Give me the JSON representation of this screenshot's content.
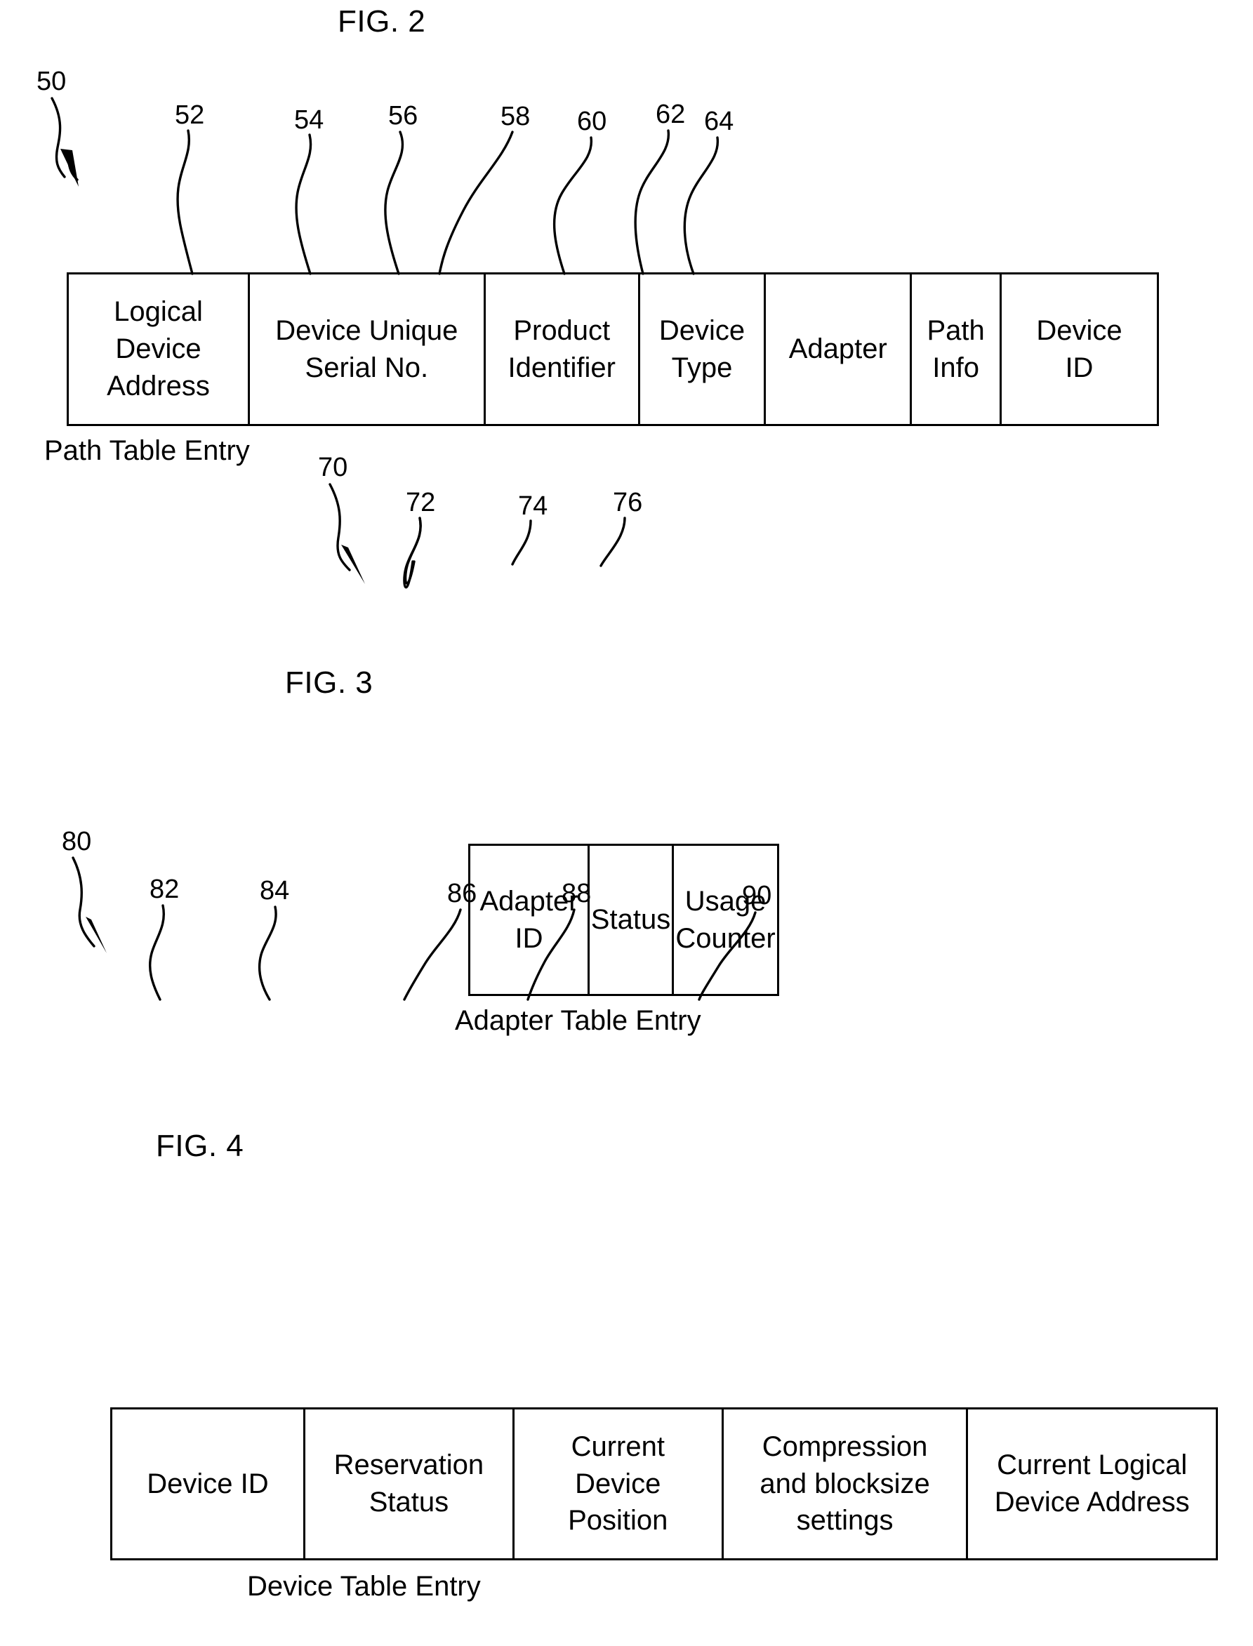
{
  "page": {
    "background": "#ffffff",
    "ink": "#000000"
  },
  "figures": [
    {
      "id": "fig2",
      "title": "FIG. 2",
      "caption": "Path Table Entry",
      "assembly_ref": "50",
      "columns": [
        {
          "ref": "52",
          "label": "Logical\nDevice\nAddress"
        },
        {
          "ref": "54",
          "label": "Device Unique\nSerial No."
        },
        {
          "ref": "56",
          "label": "Product\nIdentifier"
        },
        {
          "ref": "58",
          "label": "Device\nType"
        },
        {
          "ref": "60",
          "label": "Adapter"
        },
        {
          "ref": "62",
          "label": "Path\nInfo"
        },
        {
          "ref": "64",
          "label": "Device\nID"
        }
      ]
    },
    {
      "id": "fig3",
      "title": "FIG. 3",
      "caption": "Adapter Table Entry",
      "assembly_ref": "70",
      "columns": [
        {
          "ref": "72",
          "label": "Adapter ID"
        },
        {
          "ref": "74",
          "label": "Status"
        },
        {
          "ref": "76",
          "label": "Usage\nCounter"
        }
      ]
    },
    {
      "id": "fig4",
      "title": "FIG. 4",
      "caption": "Device Table Entry",
      "assembly_ref": "80",
      "columns": [
        {
          "ref": "82",
          "label": "Device ID"
        },
        {
          "ref": "84",
          "label": "Reservation\nStatus"
        },
        {
          "ref": "86",
          "label": "Current\nDevice\nPosition"
        },
        {
          "ref": "88",
          "label": "Compression\nand blocksize\nsettings"
        },
        {
          "ref": "90",
          "label": "Current Logical\nDevice Address"
        }
      ]
    }
  ]
}
